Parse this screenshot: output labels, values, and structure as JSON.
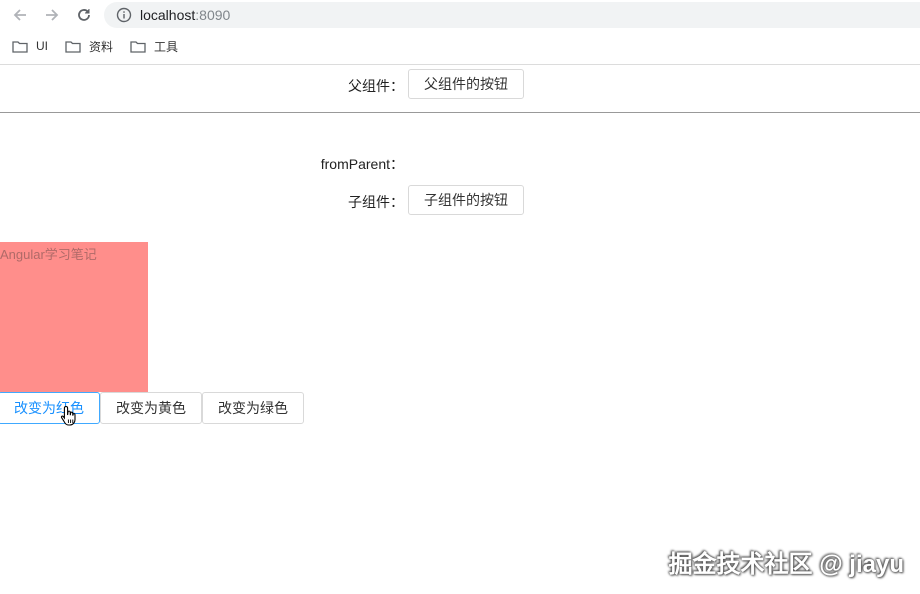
{
  "browser": {
    "address": {
      "host": "localhost",
      "port": ":8090"
    },
    "bookmarks": [
      {
        "label": "UI",
        "icon": "folder-icon"
      },
      {
        "label": "资料",
        "icon": "folder-icon"
      },
      {
        "label": "工具",
        "icon": "folder-icon"
      }
    ]
  },
  "parent": {
    "label": "父组件：",
    "button_label": "父组件的按钮"
  },
  "child": {
    "from_parent_label": "fromParent：",
    "label": "子组件：",
    "button_label": "子组件的按钮"
  },
  "color_box": {
    "text": "Angular学习笔记",
    "color": "#ff8e8b"
  },
  "color_buttons": [
    {
      "label": "改变为红色",
      "active": true
    },
    {
      "label": "改变为黄色",
      "active": false
    },
    {
      "label": "改变为绿色",
      "active": false
    }
  ],
  "watermark": "掘金技术社区 @ jiayu"
}
